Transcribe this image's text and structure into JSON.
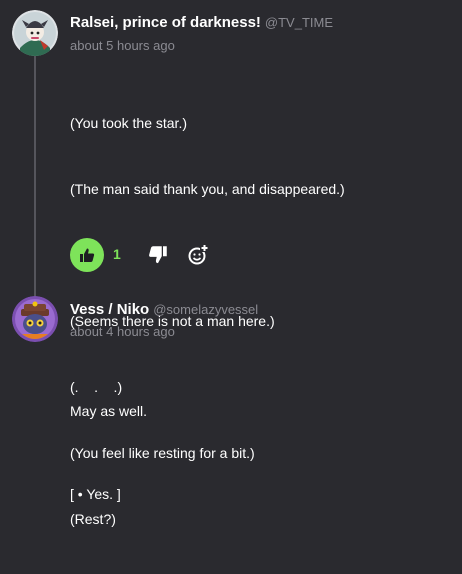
{
  "colors": {
    "background": "#2a2a2f",
    "accent_green": "#7ee35a",
    "muted_text": "#8b8b92",
    "thread_line": "#55555c"
  },
  "posts": [
    {
      "author": "Ralsei, prince of darkness!",
      "handle": "@TV_TIME",
      "time": "about 5 hours ago",
      "lines": [
        "(You took the star.)",
        "(The man said thank you, and disappeared.)",
        "",
        "(Seems there is not a man here.)",
        "(.    .    .)",
        "(You feel like resting for a bit.)",
        "(Rest?)"
      ],
      "actions": {
        "like_icon": "thumbs-up-icon",
        "like_count": "1",
        "dislike_icon": "thumbs-down-icon",
        "react_icon": "add-reaction-icon"
      }
    },
    {
      "author": "Vess / Niko",
      "handle": "@somelazyvessel",
      "time": "about 4 hours ago",
      "lines": [
        "May as well.",
        "[ • Yes. ]"
      ]
    }
  ]
}
